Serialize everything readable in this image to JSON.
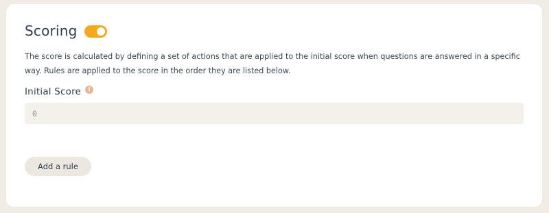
{
  "scoring": {
    "title": "Scoring",
    "enabled": true,
    "description": "The score is calculated by defining a set of actions that are applied to the initial score when questions are answered in a specific way. Rules are applied to the score in the order they are listed below.",
    "initial_score": {
      "label": "Initial Score",
      "info_icon": "info-icon",
      "value": "0"
    },
    "add_rule_label": "Add a rule"
  },
  "colors": {
    "accent": "#f5a81c",
    "page_background": "#f1ede4",
    "card_background": "#ffffff",
    "input_background": "#f4f1ea",
    "info_icon": "#e8b79a"
  }
}
